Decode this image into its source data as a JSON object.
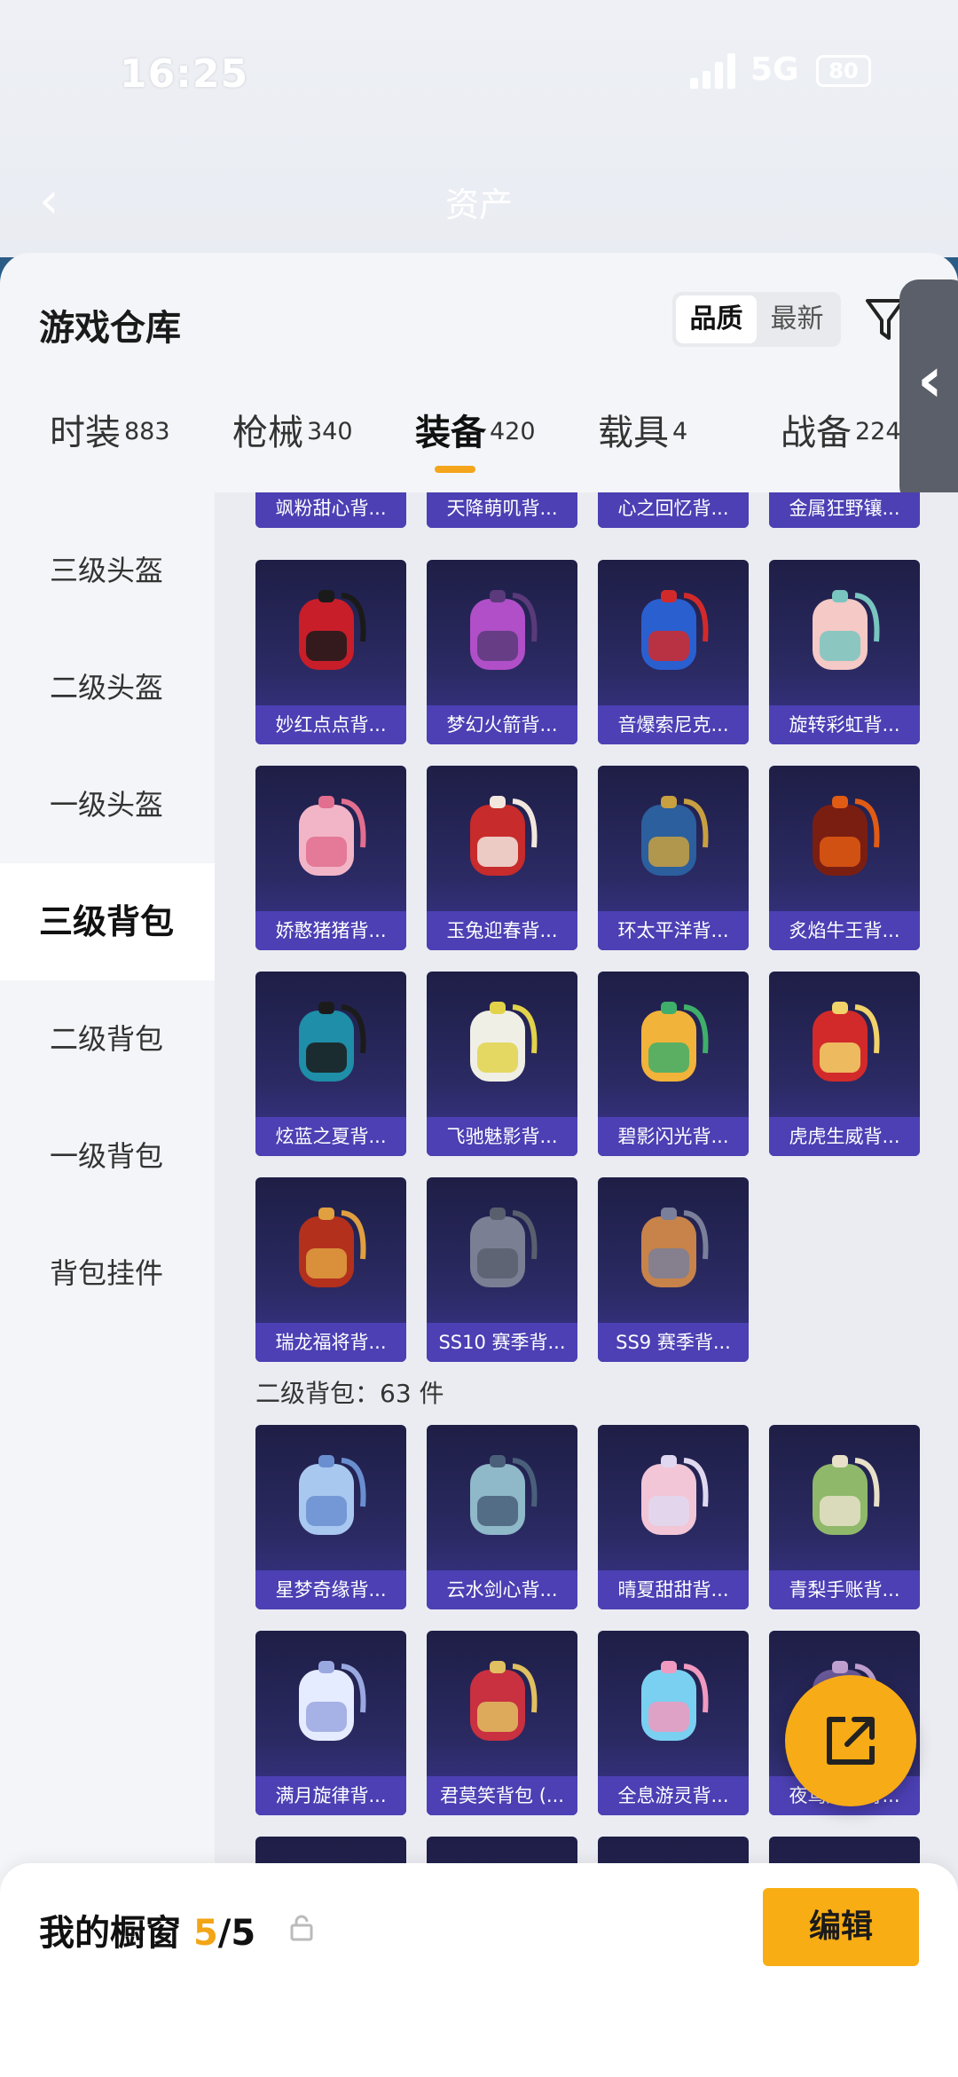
{
  "status": {
    "time": "16:25",
    "network": "5G",
    "battery": "80"
  },
  "nav": {
    "title": "资产"
  },
  "panel": {
    "title": "游戏仓库",
    "sort_options": [
      "品质",
      "最新"
    ],
    "tabs": [
      {
        "label": "时装",
        "count": "883"
      },
      {
        "label": "枪械",
        "count": "340"
      },
      {
        "label": "装备",
        "count": "420"
      },
      {
        "label": "载具",
        "count": "4"
      },
      {
        "label": "战备",
        "count": "224"
      }
    ]
  },
  "sidebar": {
    "items": [
      "三级头盔",
      "二级头盔",
      "一级头盔",
      "三级背包",
      "二级背包",
      "一级背包",
      "背包挂件"
    ]
  },
  "grid": {
    "partial_row": [
      "飒粉甜心背...",
      "天降萌叽背...",
      "心之回忆背...",
      "金属狂野镶..."
    ],
    "level3_items": [
      {
        "name": "妙红点点背...",
        "colors": [
          "#c81e2a",
          "#1a1a1a"
        ]
      },
      {
        "name": "梦幻火箭背...",
        "colors": [
          "#b04fc8",
          "#5a3a7a"
        ]
      },
      {
        "name": "音爆索尼克...",
        "colors": [
          "#2a5fd0",
          "#d22a2a"
        ]
      },
      {
        "name": "旋转彩虹背...",
        "colors": [
          "#f4c9c6",
          "#79c5c0"
        ]
      },
      {
        "name": "娇憨猪猪背...",
        "colors": [
          "#f2b5c7",
          "#e26f8f"
        ]
      },
      {
        "name": "玉兔迎春背...",
        "colors": [
          "#c72b2b",
          "#f2e7df"
        ]
      },
      {
        "name": "环太平洋背...",
        "colors": [
          "#2b5f9e",
          "#c9a040"
        ]
      },
      {
        "name": "炙焰牛王背...",
        "colors": [
          "#7a1e12",
          "#e05b14"
        ]
      },
      {
        "name": "炫蓝之夏背...",
        "colors": [
          "#1f8ea8",
          "#1b1b1b"
        ]
      },
      {
        "name": "飞驰魅影背...",
        "colors": [
          "#f0efe6",
          "#e2d34a"
        ]
      },
      {
        "name": "碧影闪光背...",
        "colors": [
          "#f2b33a",
          "#3fae6a"
        ]
      },
      {
        "name": "虎虎生威背...",
        "colors": [
          "#d22a2a",
          "#f2d36a"
        ]
      },
      {
        "name": "瑞龙福将背...",
        "colors": [
          "#b3301d",
          "#e0a040"
        ]
      },
      {
        "name": "SS10 赛季背...",
        "colors": [
          "#7b7f94",
          "#5a5f6e"
        ]
      },
      {
        "name": "SS9 赛季背...",
        "colors": [
          "#c7834a",
          "#7a7f9a"
        ]
      }
    ],
    "section_label": "二级背包：63 件",
    "level2_items": [
      {
        "name": "星梦奇缘背...",
        "colors": [
          "#a9c8f0",
          "#6a8fd0"
        ]
      },
      {
        "name": "云水剑心背...",
        "colors": [
          "#8fb8c8",
          "#4a5f7a"
        ]
      },
      {
        "name": "晴夏甜甜背...",
        "colors": [
          "#f2c6d6",
          "#e0d8f0"
        ]
      },
      {
        "name": "青梨手账背...",
        "colors": [
          "#8fb86a",
          "#e8e0c8"
        ]
      },
      {
        "name": "满月旋律背...",
        "colors": [
          "#e6ecff",
          "#9aa8e0"
        ]
      },
      {
        "name": "君莫笑背包 (...",
        "colors": [
          "#c93040",
          "#e0c060"
        ]
      },
      {
        "name": "全息游灵背...",
        "colors": [
          "#7ad0f0",
          "#f09ac0"
        ]
      },
      {
        "name": "夜鸢咸吉背...",
        "colors": [
          "#6a5a9a",
          "#c0a0d0"
        ]
      }
    ]
  },
  "bottom": {
    "title": "我的橱窗",
    "current": "5",
    "total": "/5",
    "edit_label": "编辑"
  },
  "accent": "#f4a51c"
}
